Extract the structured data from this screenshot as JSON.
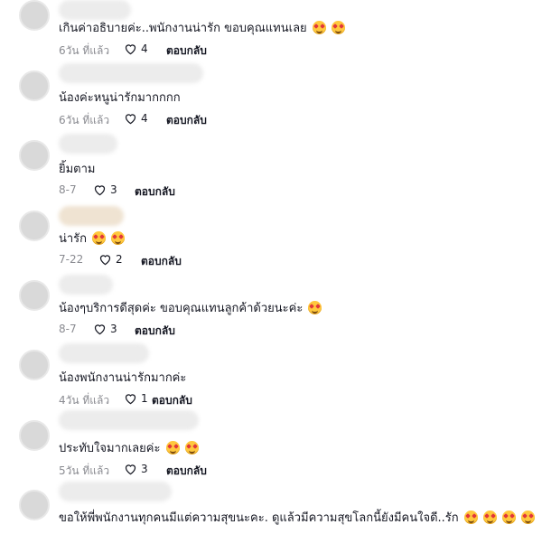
{
  "comments": [
    {
      "text": "เกินค่าอธิบายค่ะ..พนักงานน่ารัก ขอบคุณแทนเลย",
      "emojis": 2,
      "time": "6วัน ที่แล้ว",
      "likes": "4",
      "reply": "ตอบกลับ"
    },
    {
      "text": "น้องค่ะหนูน่ารักมากกกก",
      "emojis": 0,
      "time": "6วัน ที่แล้ว",
      "likes": "4",
      "reply": "ตอบกลับ"
    },
    {
      "text": "ยิ้มตาม",
      "emojis": 0,
      "time": "8-7",
      "likes": "3",
      "reply": "ตอบกลับ"
    },
    {
      "text": "น่ารัก",
      "emojis": 2,
      "time": "7-22",
      "likes": "2",
      "reply": "ตอบกลับ"
    },
    {
      "text": "น้องๆบริการดีสุดค่ะ ขอบคุณแทนลูกค้าด้วยนะค่ะ",
      "emojis": 1,
      "time": "8-7",
      "likes": "3",
      "reply": "ตอบกลับ"
    },
    {
      "text": "น้องพนักงานน่ารักมากค่ะ",
      "emojis": 0,
      "time": "4วัน ที่แล้ว",
      "likes": "1",
      "reply": "ตอบกลับ"
    },
    {
      "text": "ประทับใจมากเลยค่ะ",
      "emojis": 2,
      "time": "5วัน ที่แล้ว",
      "likes": "3",
      "reply": "ตอบกลับ"
    },
    {
      "text": "ขอให้พี่พนักงานทุกคนมีแต่ความสุขนะคะ. ดูแล้วมีความสุขโลกนี้ยังมีคนใจดี..รัก",
      "emojis": 4,
      "time": "",
      "likes": "",
      "reply": ""
    }
  ],
  "icons": {
    "like": "heart-outline-icon",
    "emoji": "smiling-face-with-hearts-icon"
  },
  "colors": {
    "text": "#161823",
    "meta": "#8a8b91",
    "placeholder": "#ececec"
  }
}
